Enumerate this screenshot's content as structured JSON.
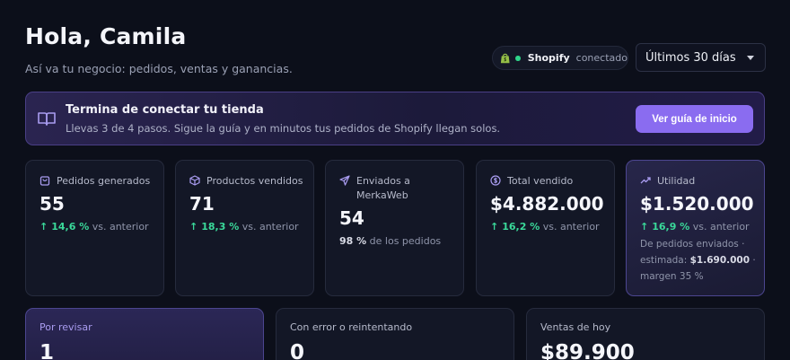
{
  "header": {
    "title": "Hola, Camila",
    "subtitle": "Así va tu negocio: pedidos, ventas y ganancias."
  },
  "integration": {
    "icon": "shopify-bag-icon",
    "name": "Shopify",
    "status": "conectado",
    "status_color": "#2fd48a"
  },
  "date_range": {
    "selected": "Últimos 30 días"
  },
  "banner": {
    "icon": "book-open-icon",
    "title": "Termina de conectar tu tienda",
    "text": "Llevas 3 de 4 pasos. Sigue la guía y en minutos tus pedidos de Shopify llegan solos.",
    "button_label": "Ver guía de inicio",
    "accent": "#8a6cf0"
  },
  "metrics": [
    {
      "icon": "shopping-bag-icon",
      "label": "Pedidos generados",
      "value": "55",
      "change": "14,6 %",
      "change_suffix": "vs. anterior"
    },
    {
      "icon": "box-icon",
      "label": "Productos vendidos",
      "value": "71",
      "change": "18,3 %",
      "change_suffix": "vs. anterior"
    },
    {
      "icon": "send-icon",
      "label": "Enviados a MerkaWeb",
      "value": "54",
      "share": "98 %",
      "share_suffix": "de los pedidos"
    },
    {
      "icon": "dollar-circle-icon",
      "label": "Total vendido",
      "value": "$4.882.000",
      "change": "16,2 %",
      "change_suffix": "vs. anterior"
    },
    {
      "icon": "trending-up-icon",
      "label": "Utilidad",
      "value": "$1.520.000",
      "change": "16,9 %",
      "change_suffix": "vs. anterior",
      "note_prefix": "De pedidos enviados · estimada:",
      "note_amount": "$1.690.000",
      "note_suffix": "· margen 35 %"
    }
  ],
  "summary": [
    {
      "label": "Por revisar",
      "value": "1"
    },
    {
      "label": "Con error o reintentando",
      "value": "0"
    },
    {
      "label": "Ventas de hoy",
      "value": "$89.900"
    }
  ],
  "colors": {
    "positive": "#3ad99a",
    "background": "#0c0f1a"
  }
}
